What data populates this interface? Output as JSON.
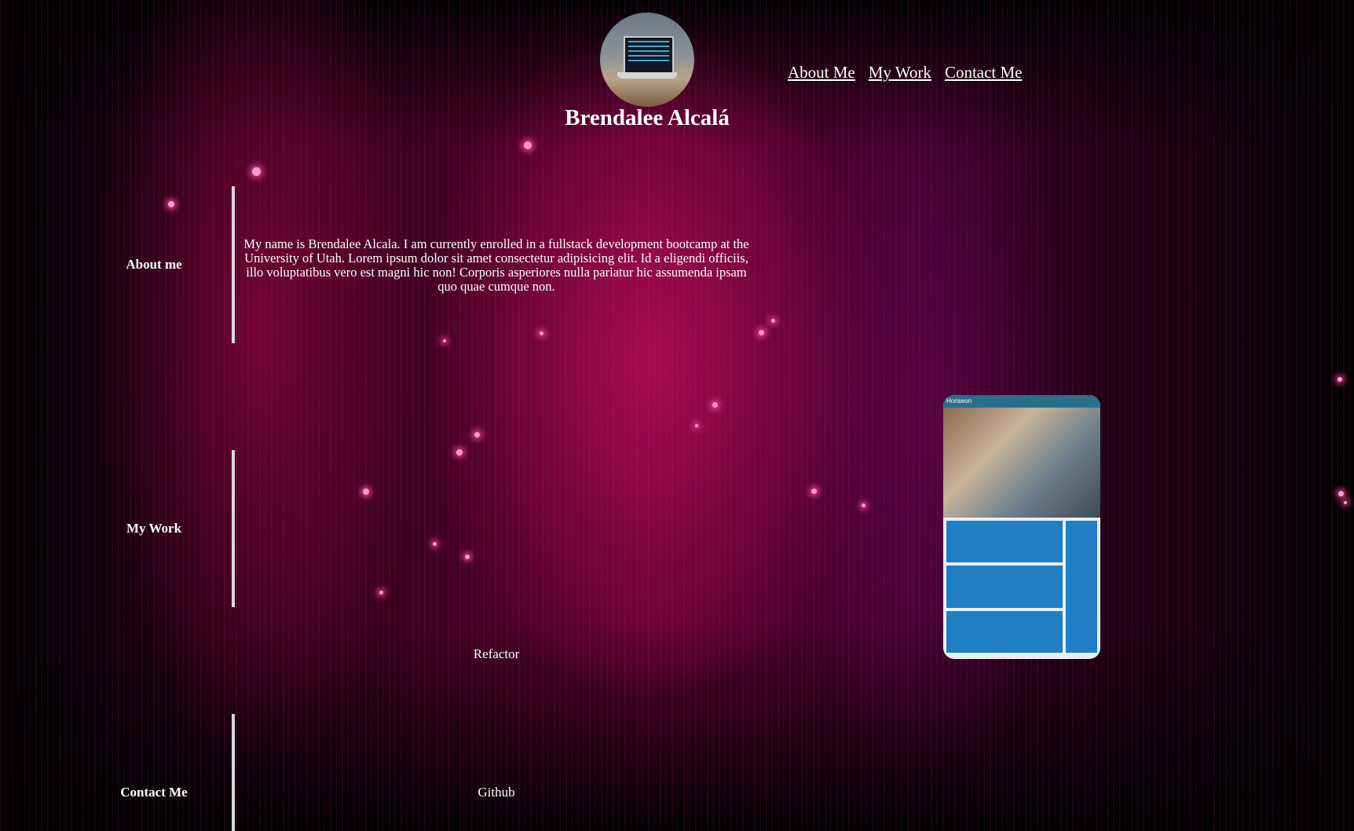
{
  "header": {
    "name": "Brendalee Alcalá",
    "avatar_icon": "laptop-desk-photo",
    "nav": [
      {
        "label": "About Me"
      },
      {
        "label": "My Work"
      },
      {
        "label": "Contact Me"
      }
    ]
  },
  "sections": {
    "about": {
      "label": "About me",
      "text": "My name is Brendalee Alcala. I am currently enrolled in a fullstack development bootcamp at the University of Utah. Lorem ipsum dolor sit amet consectetur adipisicing elit. Id a eligendi officiis, illo voluptatibus vero est magni hic non! Corporis asperiores nulla pariatur hic assumenda ipsam quo quae cumque non."
    },
    "work": {
      "label": "My Work",
      "project_label": "Refactor",
      "screenshot_brand": "Horiseon"
    },
    "contact": {
      "label": "Contact Me",
      "link_label": "Github"
    }
  },
  "colors": {
    "text": "#ffffff",
    "accent": "#e6146e",
    "divider": "#d8d8d8"
  }
}
